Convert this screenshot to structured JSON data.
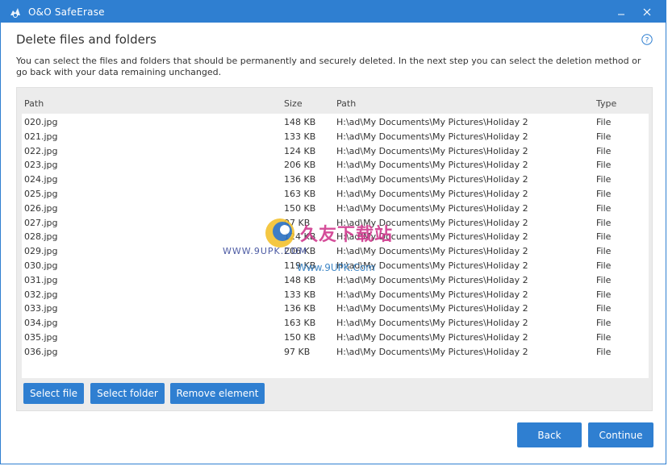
{
  "window": {
    "title": "O&O SafeErase",
    "minimize_label": "–",
    "close_label": "✕"
  },
  "page": {
    "heading": "Delete files and folders",
    "help_label": "?",
    "description": "You can select the files and folders that should be permanently and securely deleted. In the next step you can select the deletion method or go back with your data remaining unchanged."
  },
  "table": {
    "columns": {
      "name": "Path",
      "size": "Size",
      "path": "Path",
      "type": "Type"
    },
    "rows": [
      {
        "name": "020.jpg",
        "size": "148 KB",
        "path": "H:\\ad\\My Documents\\My Pictures\\Holiday 2",
        "type": "File"
      },
      {
        "name": "021.jpg",
        "size": "133 KB",
        "path": "H:\\ad\\My Documents\\My Pictures\\Holiday 2",
        "type": "File"
      },
      {
        "name": "022.jpg",
        "size": "124 KB",
        "path": "H:\\ad\\My Documents\\My Pictures\\Holiday 2",
        "type": "File"
      },
      {
        "name": "023.jpg",
        "size": "206 KB",
        "path": "H:\\ad\\My Documents\\My Pictures\\Holiday 2",
        "type": "File"
      },
      {
        "name": "024.jpg",
        "size": "136 KB",
        "path": "H:\\ad\\My Documents\\My Pictures\\Holiday 2",
        "type": "File"
      },
      {
        "name": "025.jpg",
        "size": "163 KB",
        "path": "H:\\ad\\My Documents\\My Pictures\\Holiday 2",
        "type": "File"
      },
      {
        "name": "026.jpg",
        "size": "150 KB",
        "path": "H:\\ad\\My Documents\\My Pictures\\Holiday 2",
        "type": "File"
      },
      {
        "name": "027.jpg",
        "size": "97 KB",
        "path": "H:\\ad\\My Documents\\My Pictures\\Holiday 2",
        "type": "File"
      },
      {
        "name": "028.jpg",
        "size": "124 KB",
        "path": "H:\\ad\\My Documents\\My Pictures\\Holiday 2",
        "type": "File"
      },
      {
        "name": "029.jpg",
        "size": "206 KB",
        "path": "H:\\ad\\My Documents\\My Pictures\\Holiday 2",
        "type": "File"
      },
      {
        "name": "030.jpg",
        "size": "119 KB",
        "path": "H:\\ad\\My Documents\\My Pictures\\Holiday 2",
        "type": "File"
      },
      {
        "name": "031.jpg",
        "size": "148 KB",
        "path": "H:\\ad\\My Documents\\My Pictures\\Holiday 2",
        "type": "File"
      },
      {
        "name": "032.jpg",
        "size": "133 KB",
        "path": "H:\\ad\\My Documents\\My Pictures\\Holiday 2",
        "type": "File"
      },
      {
        "name": "033.jpg",
        "size": "136 KB",
        "path": "H:\\ad\\My Documents\\My Pictures\\Holiday 2",
        "type": "File"
      },
      {
        "name": "034.jpg",
        "size": "163 KB",
        "path": "H:\\ad\\My Documents\\My Pictures\\Holiday 2",
        "type": "File"
      },
      {
        "name": "035.jpg",
        "size": "150 KB",
        "path": "H:\\ad\\My Documents\\My Pictures\\Holiday 2",
        "type": "File"
      },
      {
        "name": "036.jpg",
        "size": "97 KB",
        "path": "H:\\ad\\My Documents\\My Pictures\\Holiday 2",
        "type": "File"
      }
    ]
  },
  "actions": {
    "select_file": "Select file",
    "select_folder": "Select folder",
    "remove_element": "Remove element",
    "back": "Back",
    "continue": "Continue"
  },
  "watermark": {
    "cn_text": "久友下载站",
    "url_left": "WWW.9UPK.COM",
    "url_right": "Www.9UPK.Com"
  },
  "colors": {
    "accent": "#2f7fd1",
    "panel": "#ececec"
  },
  "icons": {
    "app": "safe-erase-app-icon",
    "help": "help-icon",
    "minimize": "minimize-icon",
    "close": "close-icon"
  }
}
